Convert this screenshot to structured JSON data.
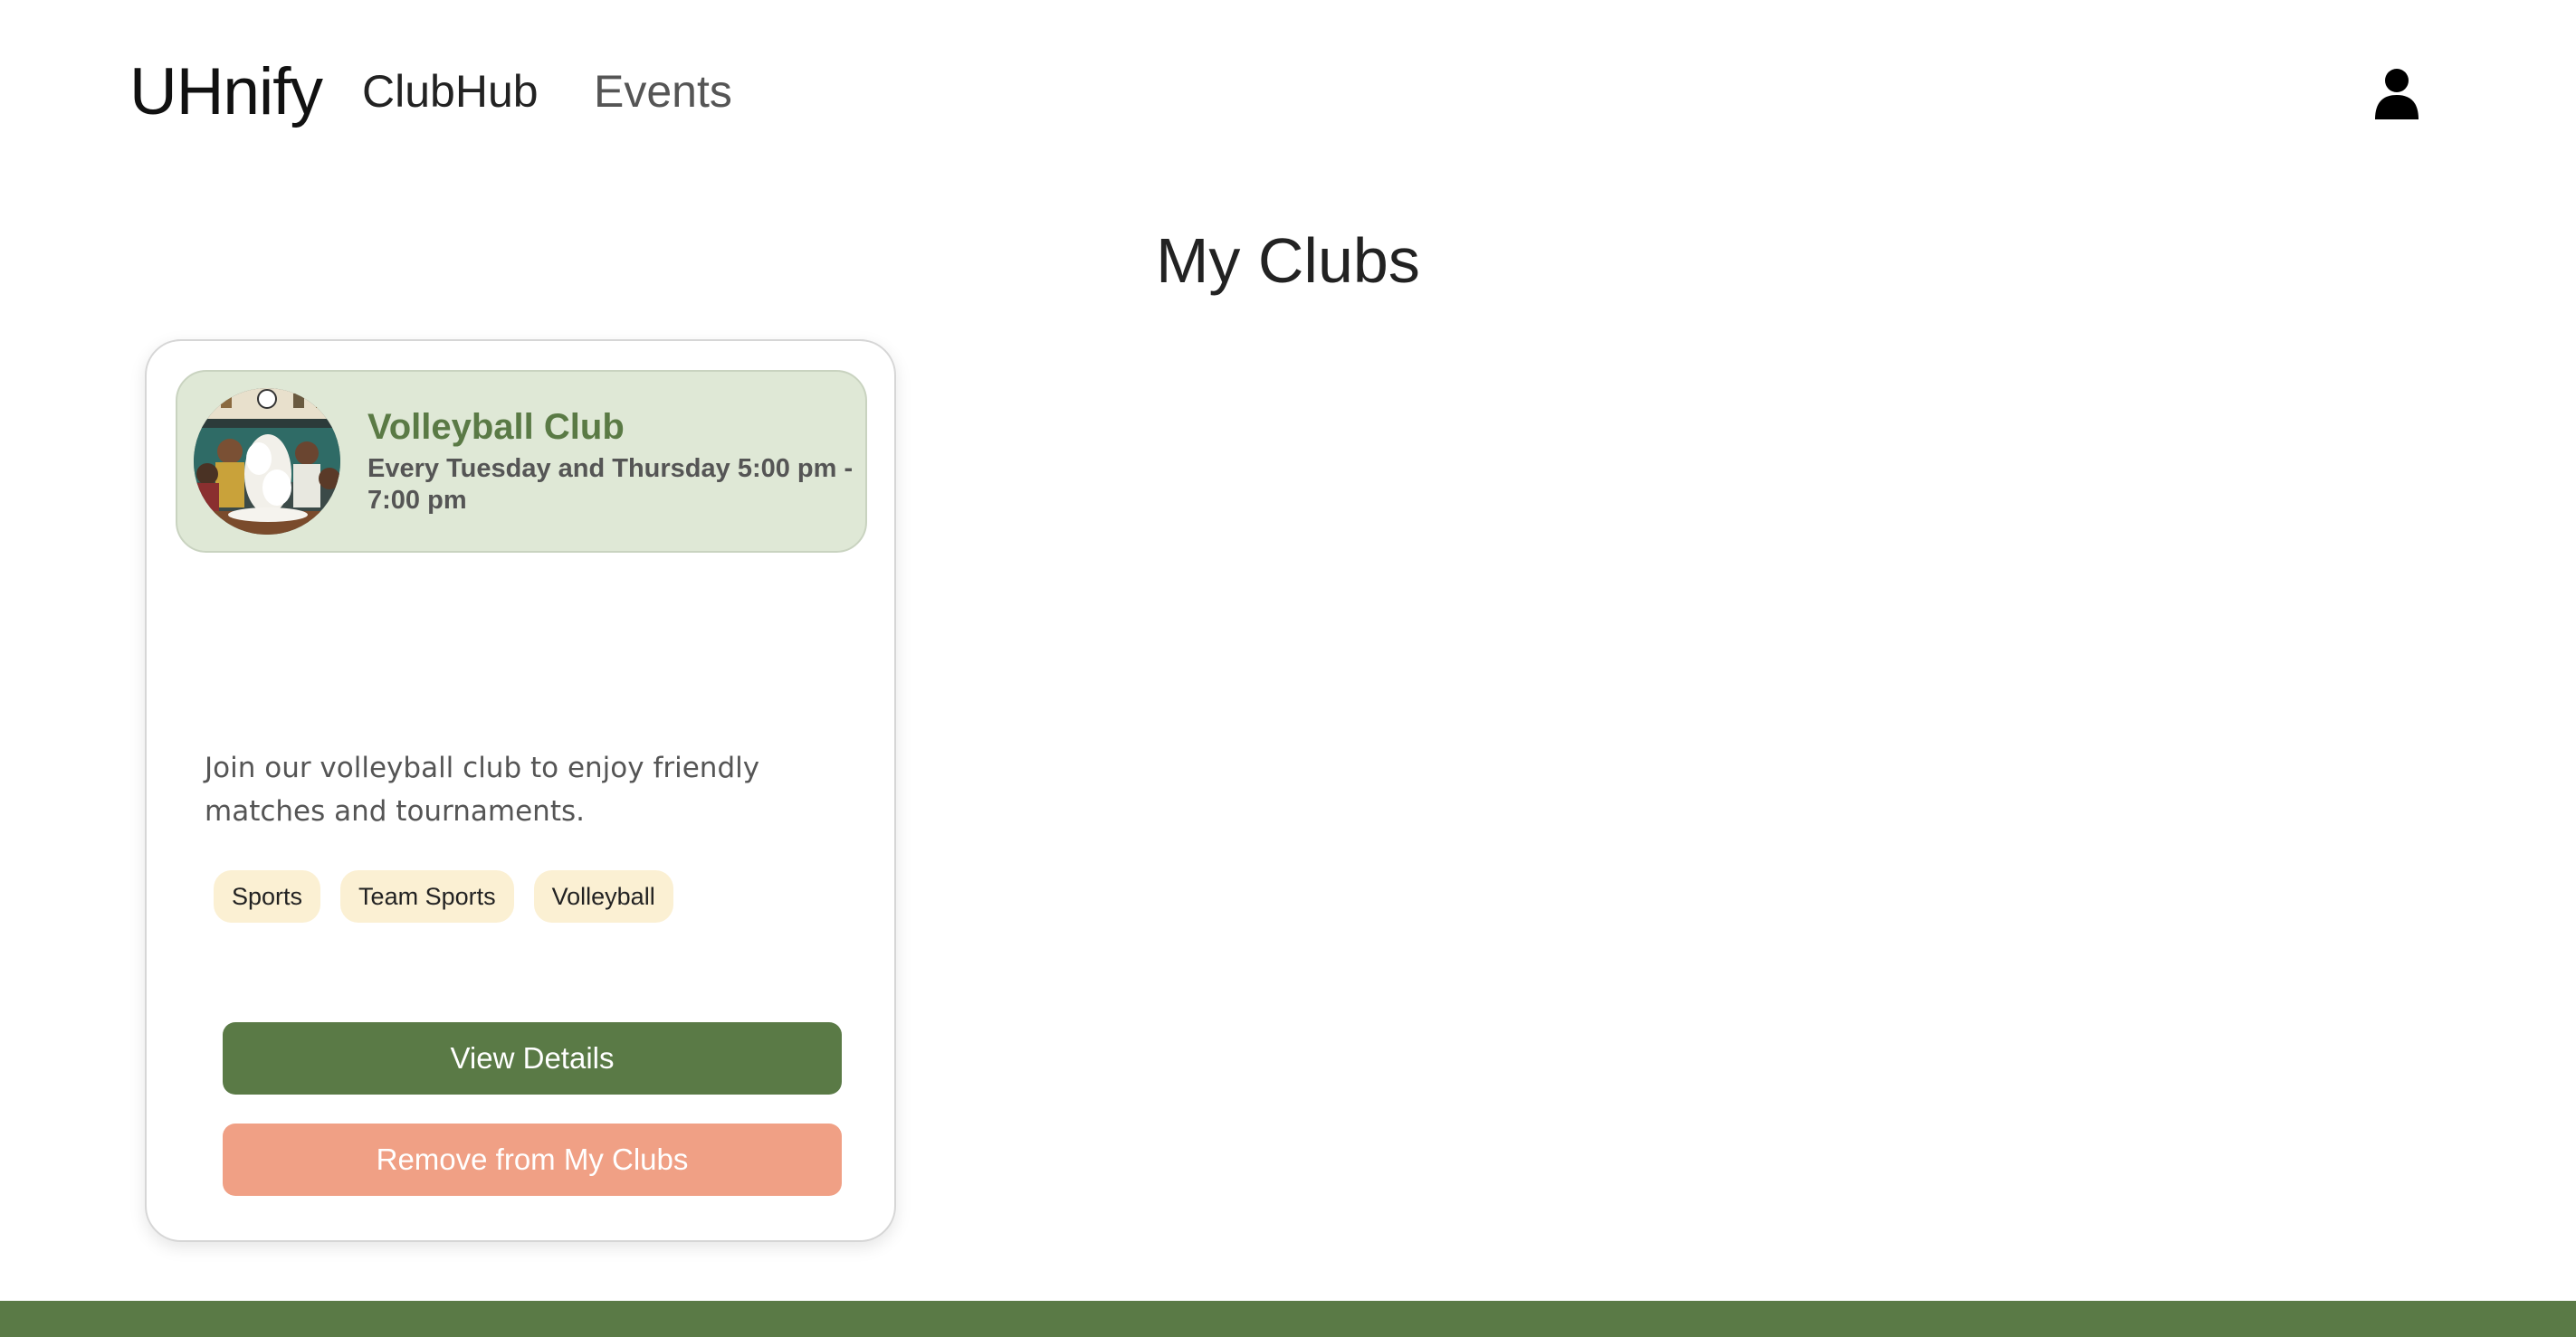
{
  "nav": {
    "brand": "UHnify",
    "links": [
      "ClubHub",
      "Events"
    ],
    "user_icon": "user-icon"
  },
  "page": {
    "title": "My Clubs"
  },
  "clubs": [
    {
      "name": "Volleyball Club",
      "schedule": "Every Tuesday and Thursday 5:00 pm - 7:00 pm",
      "description": "Join our volleyball club to enjoy friendly matches and tournaments.",
      "tags": [
        "Sports",
        "Team Sports",
        "Volleyball"
      ],
      "view_label": "View Details",
      "remove_label": "Remove from My Clubs"
    }
  ],
  "colors": {
    "primary_green": "#5a7a46",
    "header_bg": "#dfe8d6",
    "tag_bg": "#fbf0d3",
    "remove_btn": "#f0a085"
  }
}
